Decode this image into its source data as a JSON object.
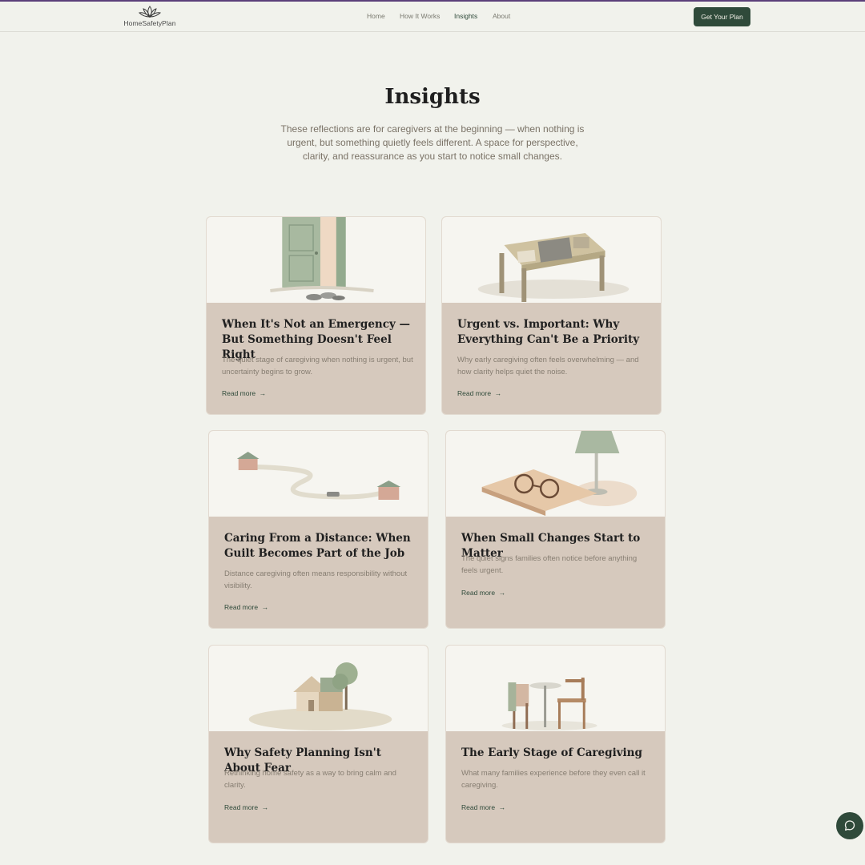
{
  "header": {
    "logo_text": "HomeSafetyPlan",
    "nav": [
      {
        "label": "Home",
        "active": false
      },
      {
        "label": "How It Works",
        "active": false
      },
      {
        "label": "Insights",
        "active": true
      },
      {
        "label": "About",
        "active": false
      }
    ],
    "cta_label": "Get Your Plan"
  },
  "hero": {
    "title": "Insights",
    "subtitle": "These reflections are for caregivers at the beginning — when nothing is urgent, but something quietly feels different. A space for perspective, clarity, and reassurance as you start to notice small changes."
  },
  "cards": [
    {
      "title": "When It's Not an Emergency — But Something Doesn't Feel Right",
      "description": "The quiet stage of caregiving when nothing is urgent, but uncertainty begins to grow.",
      "link": "Read more",
      "image": "open-door-slippers-illustration"
    },
    {
      "title": "Urgent vs. Important: Why Everything Can't Be a Priority",
      "description": "Why early caregiving often feels overwhelming — and how clarity helps quiet the noise.",
      "link": "Read more",
      "image": "cluttered-table-illustration"
    },
    {
      "title": "Caring From a Distance: When Guilt Becomes Part of the Job",
      "description": "Distance caregiving often means responsibility without visibility.",
      "link": "Read more",
      "image": "road-between-houses-illustration"
    },
    {
      "title": "When Small Changes Start to Matter",
      "description": "The quiet signs families often notice before anything feels urgent.",
      "link": "Read more",
      "image": "book-glasses-lamp-illustration"
    },
    {
      "title": "Why Safety Planning Isn't About Fear",
      "description": "Rethinking home safety as a way to bring calm and clarity.",
      "link": "Read more",
      "image": "house-tree-illustration"
    },
    {
      "title": "The Early Stage of Caregiving",
      "description": "What many families experience before they even call it caregiving.",
      "link": "Read more",
      "image": "bistro-chairs-illustration"
    }
  ],
  "colors": {
    "accent": "#2f4a3a",
    "background": "#f1f2ec",
    "card": "#d6c9bd",
    "top_bar": "#5b3f7a"
  },
  "icons": [
    "lotus-logo-icon",
    "arrow-right-icon",
    "chat-bubble-icon"
  ]
}
